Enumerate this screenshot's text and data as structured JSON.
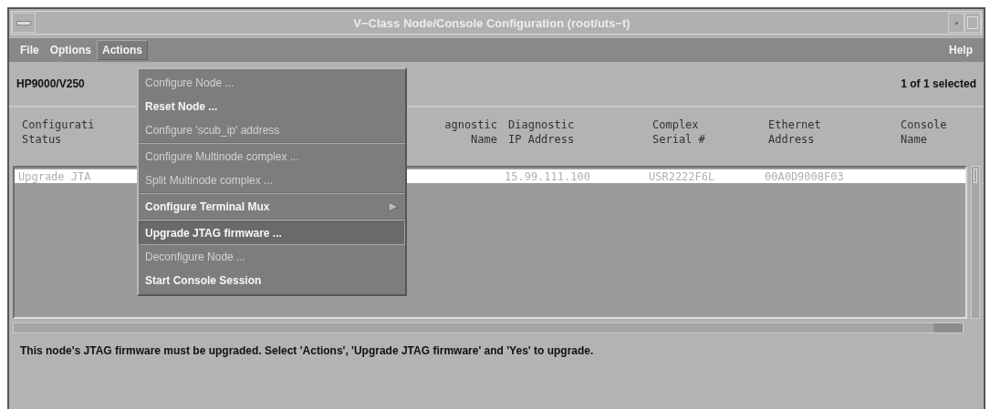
{
  "window": {
    "title": "V−Class Node/Console Configuration  (root/uts−t)"
  },
  "menubar": {
    "items": [
      {
        "label": "File",
        "selected": false
      },
      {
        "label": "Options",
        "selected": false
      },
      {
        "label": "Actions",
        "selected": true
      }
    ],
    "help": "Help"
  },
  "info_bar": {
    "node": "HP9000/V250",
    "count": "1 of 1 selected"
  },
  "table": {
    "columns": [
      {
        "heading": [
          "Configurati",
          "Status"
        ],
        "cells": [
          "Upgrade JTA"
        ]
      },
      {
        "heading": [
          "agnostic",
          "Name"
        ]
      },
      {
        "heading": [
          "Diagnostic",
          "IP Address"
        ],
        "cells": [
          "15.99.111.100"
        ]
      },
      {
        "heading": [
          "Complex",
          "Serial #"
        ],
        "cells": [
          "USR2222F6L"
        ]
      },
      {
        "heading": [
          "Ethernet",
          "Address"
        ],
        "cells": [
          "00A0D9008F03"
        ]
      },
      {
        "heading": [
          "Console",
          "Name"
        ]
      }
    ],
    "rows": [
      {
        "selected": true
      }
    ]
  },
  "actions_menu": {
    "groups": [
      {
        "items": [
          {
            "label": "Configure Node ...",
            "disabled": true,
            "selected": false
          },
          {
            "label": "Reset Node ...",
            "disabled": false,
            "selected": false
          },
          {
            "label": "Configure 'scub_ip' address",
            "disabled": true,
            "selected": false
          }
        ]
      },
      {
        "items": [
          {
            "label": "Configure Multinode complex ...",
            "disabled": true,
            "selected": false
          },
          {
            "label": "Split Multinode complex ...",
            "disabled": true,
            "selected": false
          }
        ]
      },
      {
        "items": [
          {
            "label": "Configure Terminal Mux",
            "disabled": false,
            "selected": false,
            "submenu": true
          }
        ]
      },
      {
        "items": [
          {
            "label": "Upgrade JTAG firmware ...",
            "disabled": false,
            "selected": true
          },
          {
            "label": "Deconfigure Node ...",
            "disabled": true,
            "selected": false
          },
          {
            "label": "Start Console Session",
            "disabled": false,
            "selected": false
          }
        ]
      }
    ]
  },
  "message": "This node's JTAG firmware must be upgraded. Select 'Actions', 'Upgrade JTAG firmware' and 'Yes' to upgrade."
}
